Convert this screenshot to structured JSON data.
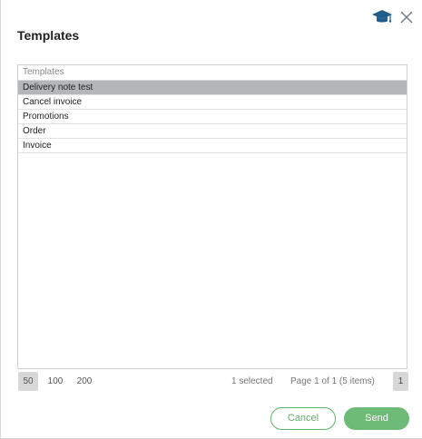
{
  "dialog": {
    "title": "Templates",
    "icons": [
      "graduation-cap-icon",
      "close-icon"
    ],
    "accent_color": "#1f5d8c",
    "button_color": "#6dbb76"
  },
  "grid": {
    "header": "Templates",
    "rows": [
      {
        "label": "Delivery note test",
        "selected": true
      },
      {
        "label": "Cancel invoice",
        "selected": false
      },
      {
        "label": "Promotions",
        "selected": false
      },
      {
        "label": "Order",
        "selected": false
      },
      {
        "label": "Invoice",
        "selected": false
      }
    ]
  },
  "pager": {
    "page_sizes": [
      "50",
      "100",
      "200"
    ],
    "active_page_size": "50",
    "selected_info": "1 selected",
    "page_info": "Page 1 of 1 (5 items)",
    "current_page": "1"
  },
  "buttons": {
    "cancel": "Cancel",
    "send": "Send"
  }
}
